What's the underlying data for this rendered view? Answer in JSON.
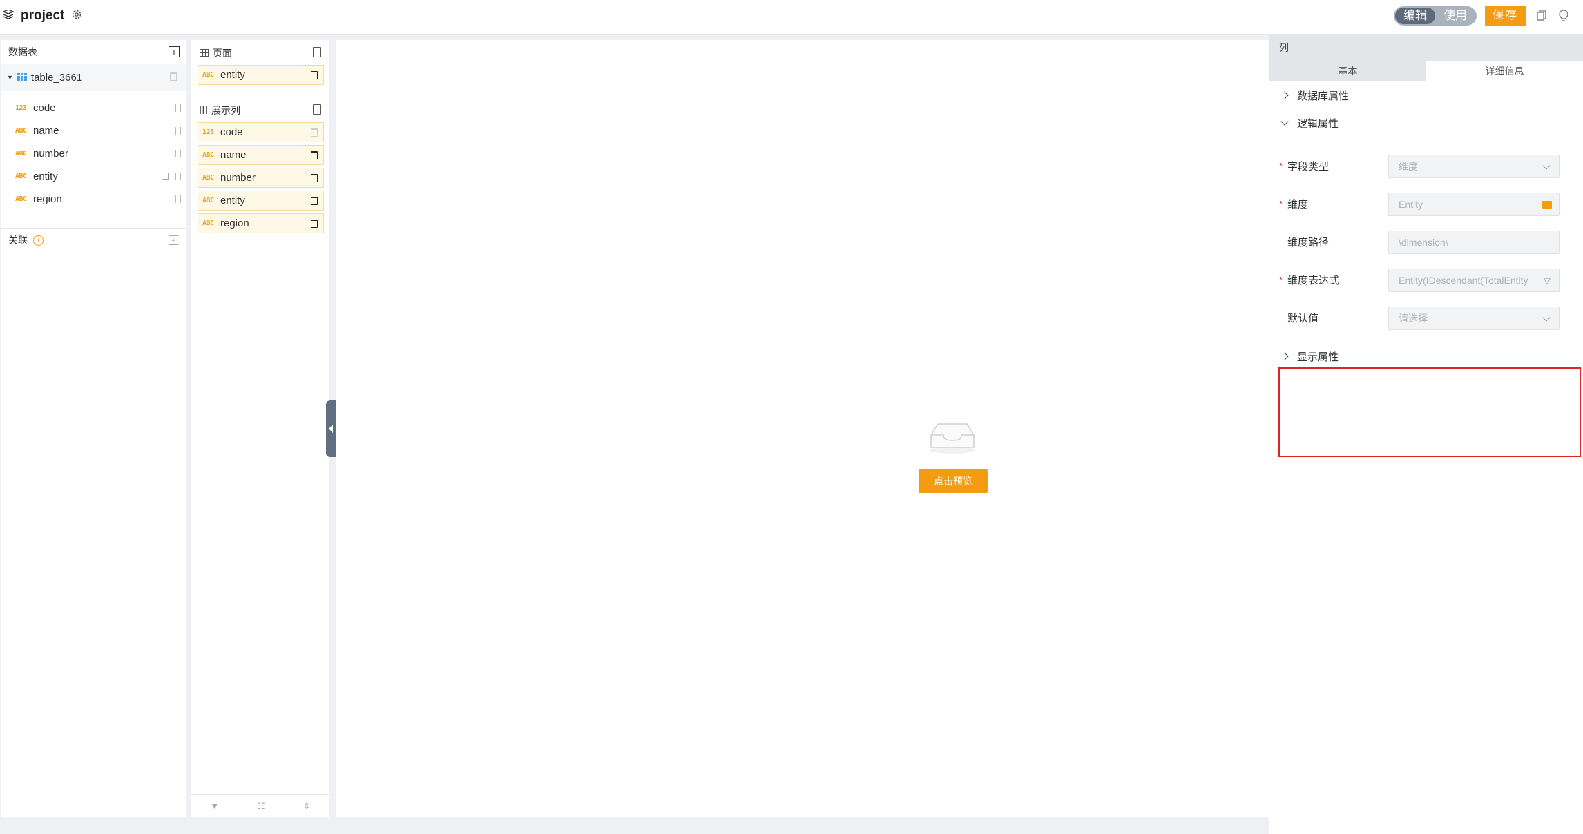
{
  "header": {
    "project_title": "project",
    "mode_edit": "编辑",
    "mode_use": "使用",
    "save_label": "保存"
  },
  "data_table": {
    "title": "数据表",
    "table_name": "table_3661",
    "fields": [
      {
        "type": "123",
        "name": "code"
      },
      {
        "type": "ABC",
        "name": "name"
      },
      {
        "type": "ABC",
        "name": "number"
      },
      {
        "type": "ABC",
        "name": "entity"
      },
      {
        "type": "ABC",
        "name": "region"
      }
    ],
    "association_title": "关联"
  },
  "page_section": {
    "title": "页面",
    "items": [
      {
        "type": "ABC",
        "name": "entity"
      }
    ]
  },
  "display_columns": {
    "title": "展示列",
    "items": [
      {
        "type": "123",
        "name": "code"
      },
      {
        "type": "ABC",
        "name": "name"
      },
      {
        "type": "ABC",
        "name": "number"
      },
      {
        "type": "ABC",
        "name": "entity"
      },
      {
        "type": "ABC",
        "name": "region"
      }
    ]
  },
  "canvas": {
    "preview_label": "点击预览"
  },
  "properties": {
    "title": "列",
    "tabs": [
      "基本",
      "详细信息"
    ],
    "active_tab": "详细信息",
    "sections": {
      "database": "数据库属性",
      "logic": "逻辑属性",
      "display": "显示属性"
    },
    "form": {
      "field_type": {
        "label": "字段类型",
        "value": "维度"
      },
      "dimension": {
        "label": "维度",
        "value": "Entity"
      },
      "dimension_path": {
        "label": "维度路径",
        "value": "\\dimension\\"
      },
      "dimension_expr": {
        "label": "维度表达式",
        "value": "Entity(IDescendant(TotalEntity"
      },
      "default_value": {
        "label": "默认值",
        "placeholder": "请选择"
      }
    }
  },
  "colors": {
    "accent": "#f39c12",
    "toggle_active": "#5b6b7c",
    "required": "#e53935",
    "highlight_box": "#e02424"
  }
}
